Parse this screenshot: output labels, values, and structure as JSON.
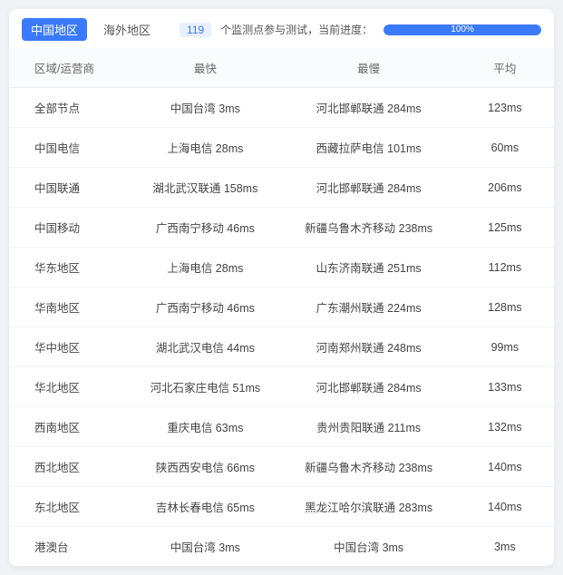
{
  "tabs": {
    "china": "中国地区",
    "overseas": "海外地区"
  },
  "status": {
    "count": "119",
    "text": "个监测点参与测试，当前进度：",
    "progress": "100%"
  },
  "columns": {
    "region": "区域/运营商",
    "fastest": "最快",
    "slowest": "最慢",
    "average": "平均"
  },
  "rows": [
    {
      "region": "全部节点",
      "fastest": "中国台湾 3ms",
      "slowest": "河北邯郸联通 284ms",
      "average": "123ms"
    },
    {
      "region": "中国电信",
      "fastest": "上海电信 28ms",
      "slowest": "西藏拉萨电信 101ms",
      "average": "60ms"
    },
    {
      "region": "中国联通",
      "fastest": "湖北武汉联通 158ms",
      "slowest": "河北邯郸联通 284ms",
      "average": "206ms"
    },
    {
      "region": "中国移动",
      "fastest": "广西南宁移动 46ms",
      "slowest": "新疆乌鲁木齐移动 238ms",
      "average": "125ms"
    },
    {
      "region": "华东地区",
      "fastest": "上海电信 28ms",
      "slowest": "山东济南联通 251ms",
      "average": "112ms"
    },
    {
      "region": "华南地区",
      "fastest": "广西南宁移动 46ms",
      "slowest": "广东潮州联通 224ms",
      "average": "128ms"
    },
    {
      "region": "华中地区",
      "fastest": "湖北武汉电信 44ms",
      "slowest": "河南郑州联通 248ms",
      "average": "99ms"
    },
    {
      "region": "华北地区",
      "fastest": "河北石家庄电信 51ms",
      "slowest": "河北邯郸联通 284ms",
      "average": "133ms"
    },
    {
      "region": "西南地区",
      "fastest": "重庆电信 63ms",
      "slowest": "贵州贵阳联通 211ms",
      "average": "132ms"
    },
    {
      "region": "西北地区",
      "fastest": "陕西西安电信 66ms",
      "slowest": "新疆乌鲁木齐移动 238ms",
      "average": "140ms"
    },
    {
      "region": "东北地区",
      "fastest": "吉林长春电信 65ms",
      "slowest": "黑龙江哈尔滨联通 283ms",
      "average": "140ms"
    },
    {
      "region": "港澳台",
      "fastest": "中国台湾 3ms",
      "slowest": "中国台湾 3ms",
      "average": "3ms"
    }
  ]
}
